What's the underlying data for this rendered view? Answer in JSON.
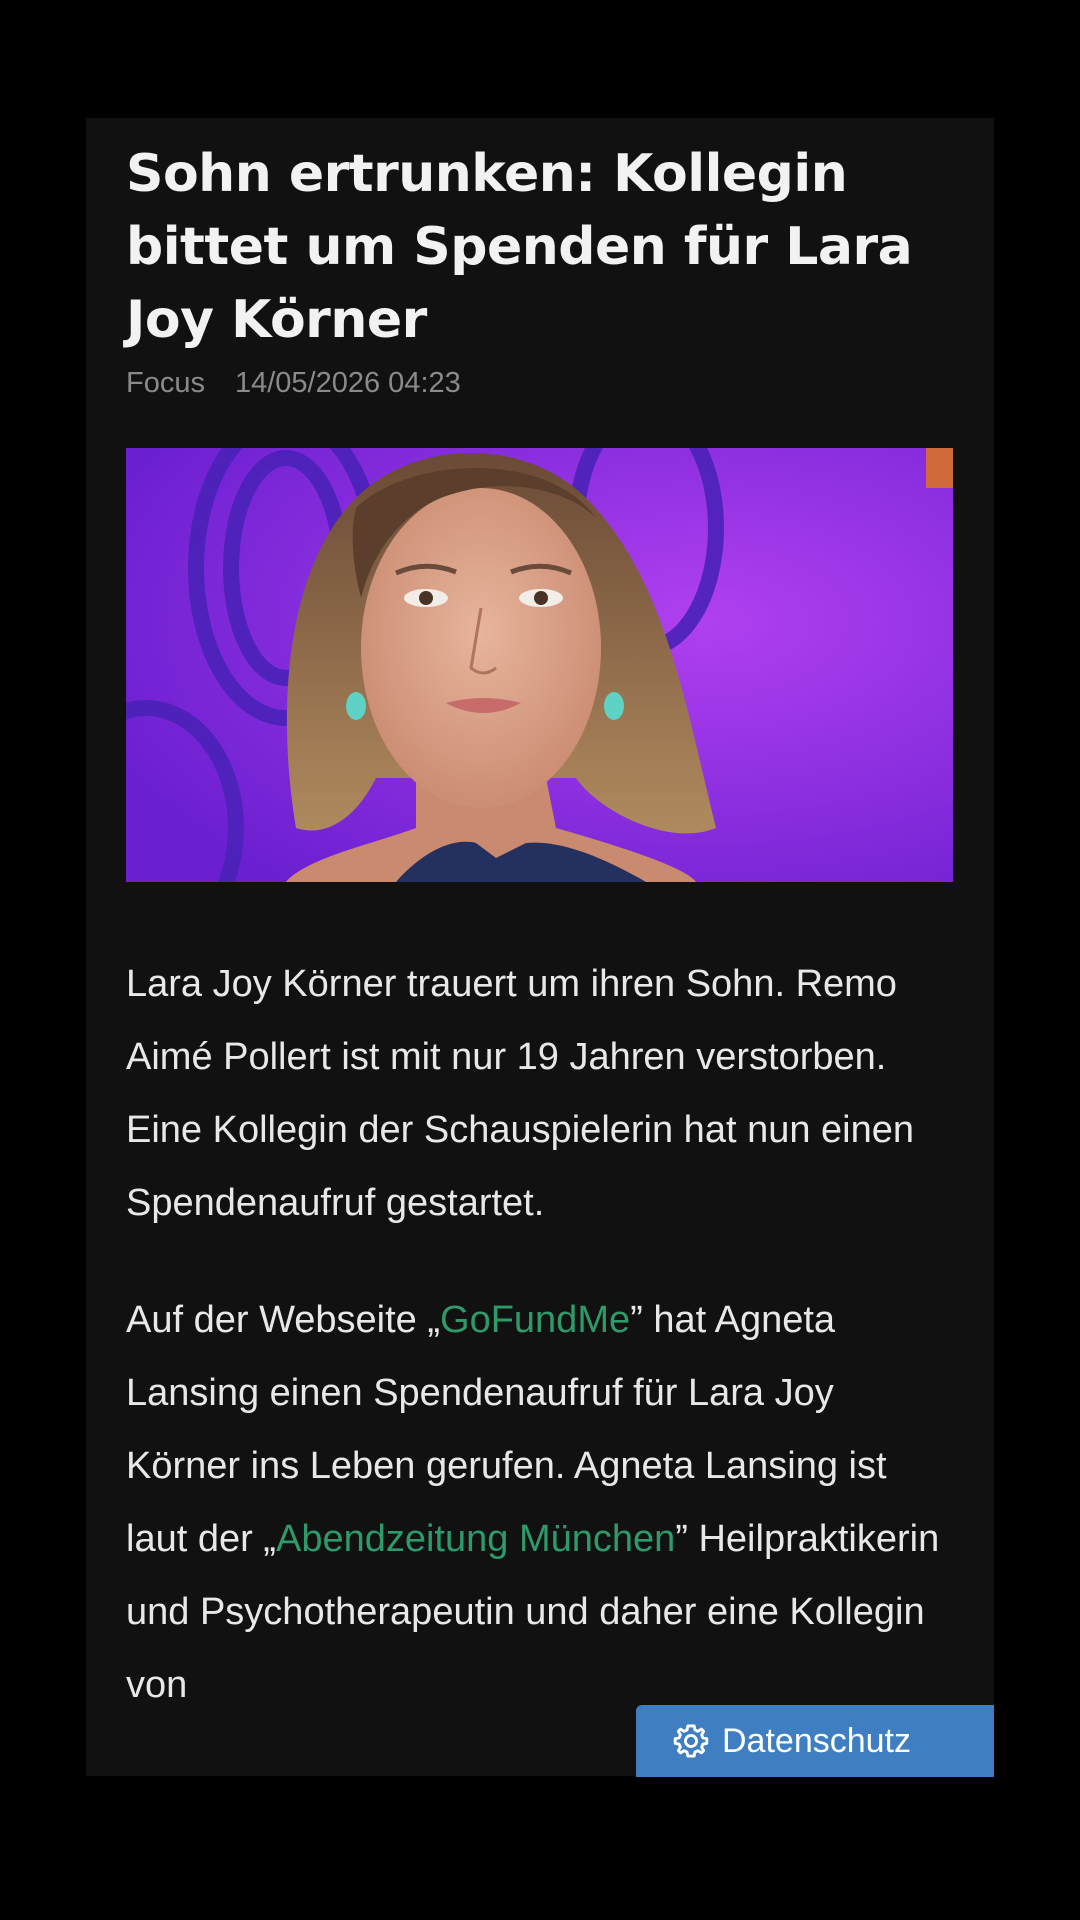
{
  "article": {
    "headline": "Sohn ertrunken: Kollegin bittet um Spenden für Lara Joy Körner",
    "source": "Focus",
    "timestamp": "14/05/2026 04:23",
    "paragraph1": "Lara Joy Körner trauert um ihren Sohn. Remo Aimé Pollert ist mit nur 19 Jahren verstorben. Eine Kollegin der Schauspielerin hat nun einen Spendenaufruf gestartet.",
    "paragraph2": {
      "part1": "Auf der Webseite „",
      "link1": "GoFundMe",
      "part2": "” hat Agneta Lansing einen Spendenaufruf für Lara Joy Körner ins Leben gerufen. Agneta Lansing ist laut der „",
      "link2": "Abendzeitung München",
      "part3": "” Heilpraktikerin und Psychotherapeutin und daher eine Kollegin von"
    }
  },
  "privacy_button": {
    "label": "Datenschutz",
    "icon": "gear-icon"
  },
  "colors": {
    "background": "#000000",
    "card": "#111111",
    "link": "#2e9a6a",
    "button": "#3f7fc1"
  }
}
